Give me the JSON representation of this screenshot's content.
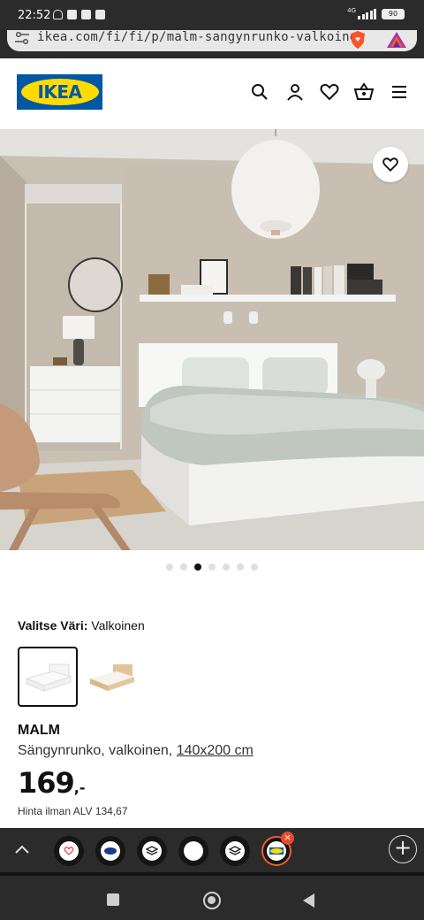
{
  "status_bar": {
    "time": "22:52",
    "network": "4G",
    "battery": "90"
  },
  "browser": {
    "url": "ikea.com/fi/fi/p/malm-sangynrunko-valkoine",
    "icons": [
      "tune-icon",
      "brave-shield-icon",
      "brave-rewards-icon"
    ]
  },
  "header": {
    "logo_text": "IKEA",
    "icons": [
      "search-icon",
      "account-icon",
      "favorites-icon",
      "cart-icon",
      "menu-icon"
    ]
  },
  "gallery": {
    "image_count": 7,
    "active_index": 2
  },
  "product": {
    "color_label": "Valitse Väri:",
    "color_value": "Valkoinen",
    "name": "MALM",
    "description": "Sängynrunko, valkoinen,",
    "size": "140x200 cm",
    "price": "169",
    "price_suffix": ",-",
    "vat_text": "Hinta ilman ALV 134,67",
    "swatches": [
      "white",
      "oak veneer"
    ]
  },
  "toolbar": {
    "new_tab": "+",
    "close_badge": "×"
  },
  "colors": {
    "ikea_blue": "#0058a3",
    "ikea_yellow": "#ffdb00",
    "brave_orange": "#fb542b",
    "chrome_dark": "#2b2b2b"
  }
}
